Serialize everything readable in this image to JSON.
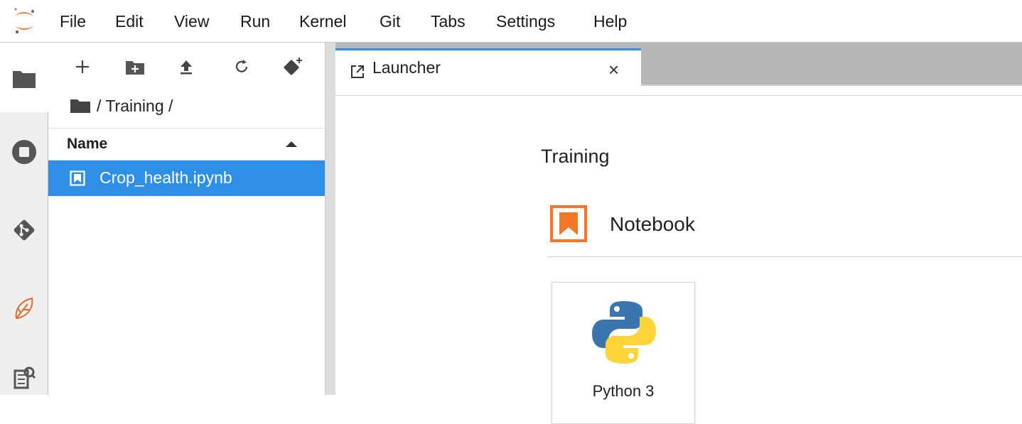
{
  "menubar": {
    "items": [
      "File",
      "Edit",
      "View",
      "Run",
      "Kernel",
      "Git",
      "Tabs",
      "Settings",
      "Help"
    ]
  },
  "activity_bar": {
    "items": [
      "folder-icon",
      "running-sessions-icon",
      "git-icon",
      "extension-icon",
      "property-inspector-icon"
    ]
  },
  "file_browser": {
    "toolbar": [
      "new-launcher-icon",
      "new-folder-icon",
      "upload-icon",
      "refresh-icon",
      "git-clone-icon"
    ],
    "breadcrumb": "/ Training /",
    "column_header": "Name",
    "files": [
      {
        "name": "Crop_health.ipynb",
        "selected": true
      }
    ]
  },
  "tabs": [
    {
      "label": "Launcher",
      "active": true,
      "close": "×"
    }
  ],
  "launcher": {
    "cwd_title": "Training",
    "section_title": "Notebook",
    "kernels": [
      {
        "label": "Python 3"
      }
    ]
  },
  "colors": {
    "accent": "#2f8ee6",
    "notebook_orange": "#f37726",
    "python_blue": "#3a75b0",
    "python_yellow": "#ffd43b"
  }
}
